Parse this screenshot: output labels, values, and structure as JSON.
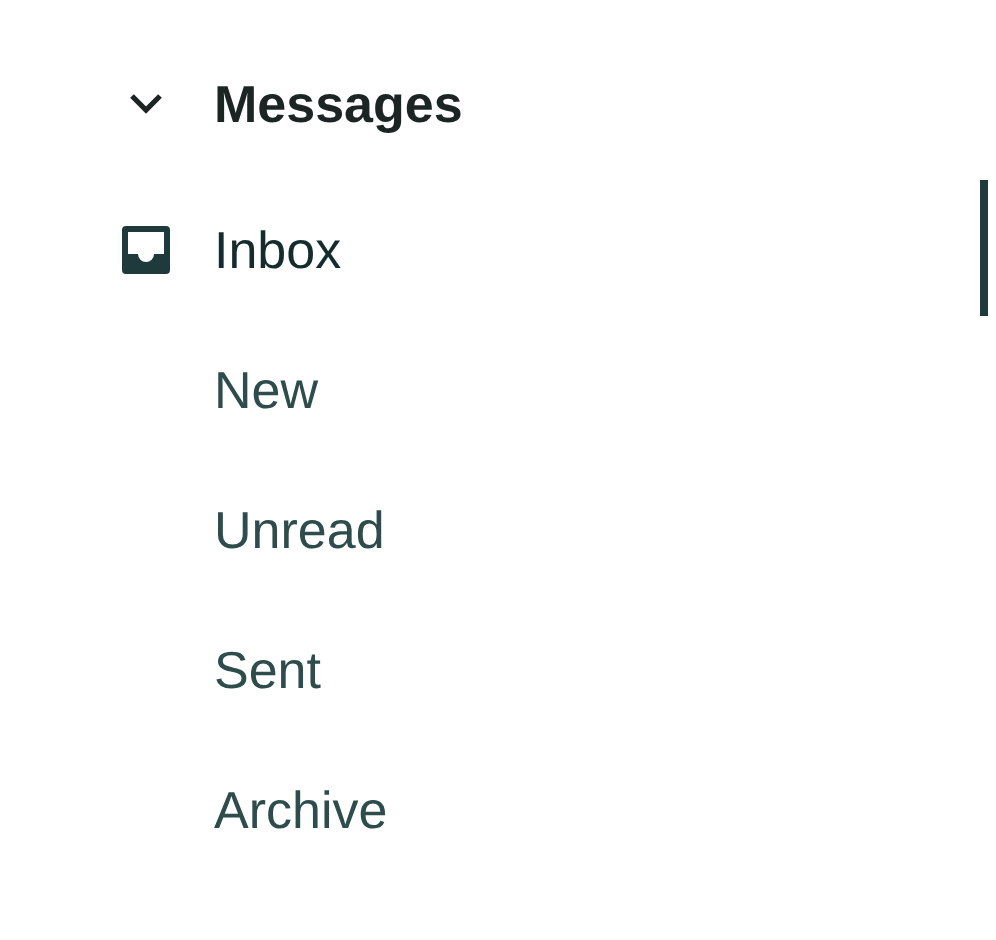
{
  "section": {
    "title": "Messages",
    "expanded": true
  },
  "items": [
    {
      "label": "Inbox",
      "selected": true
    },
    {
      "label": "New",
      "selected": false
    },
    {
      "label": "Unread",
      "selected": false
    },
    {
      "label": "Sent",
      "selected": false
    },
    {
      "label": "Archive",
      "selected": false
    }
  ]
}
